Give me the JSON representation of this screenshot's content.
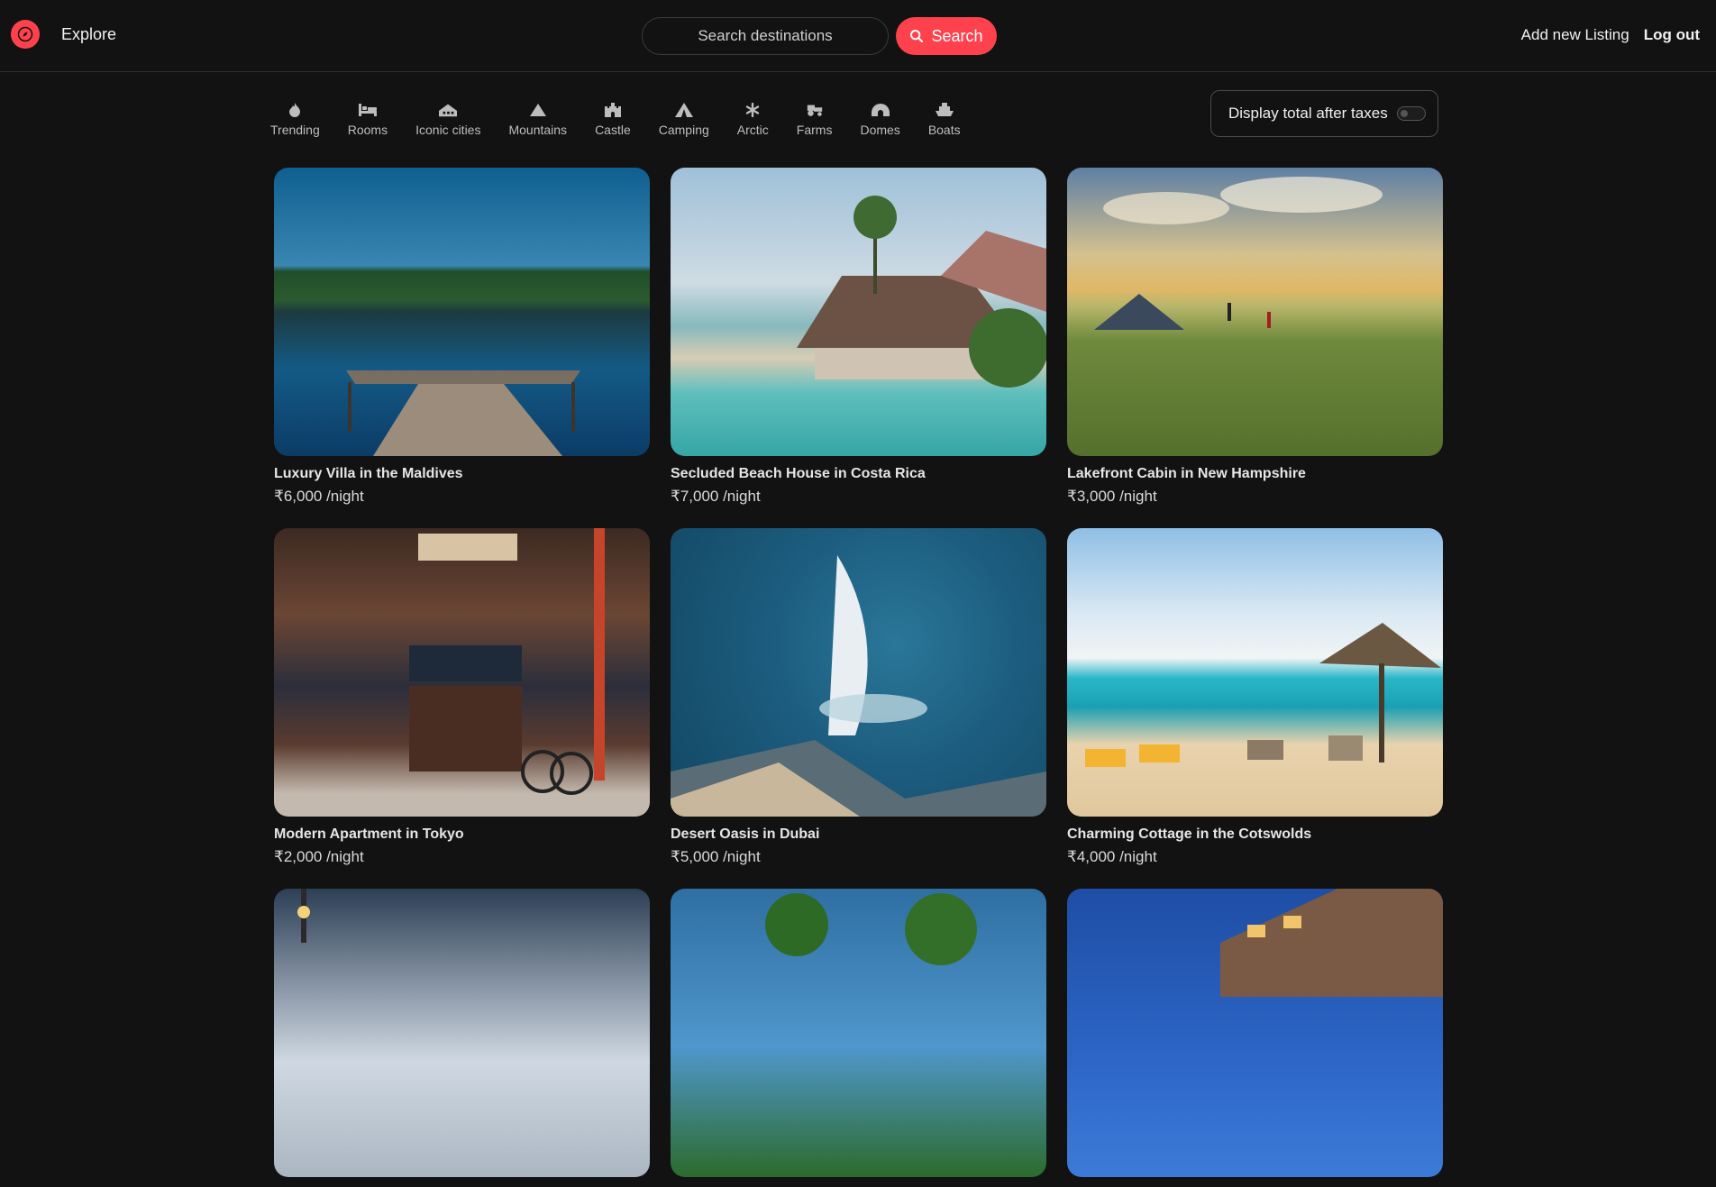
{
  "navbar": {
    "brand_label": "Explore",
    "search_placeholder": "Search destinations",
    "search_button": "Search",
    "add_listing": "Add new Listing",
    "logout": "Log out",
    "accent_color": "#fe424d"
  },
  "filters": [
    {
      "label": "Trending",
      "icon": "fire-icon"
    },
    {
      "label": "Rooms",
      "icon": "bed-icon"
    },
    {
      "label": "Iconic cities",
      "icon": "city-icon"
    },
    {
      "label": "Mountains",
      "icon": "mountain-icon"
    },
    {
      "label": "Castle",
      "icon": "castle-icon"
    },
    {
      "label": "Camping",
      "icon": "tent-icon"
    },
    {
      "label": "Arctic",
      "icon": "snowflake-icon"
    },
    {
      "label": "Farms",
      "icon": "tractor-icon"
    },
    {
      "label": "Domes",
      "icon": "igloo-icon"
    },
    {
      "label": "Boats",
      "icon": "ship-icon"
    }
  ],
  "tax_toggle": {
    "label": "Display total after taxes",
    "enabled": false
  },
  "listings": [
    {
      "title": "Luxury Villa in the Maldives",
      "price": "₹6,000 /night"
    },
    {
      "title": "Secluded Beach House in Costa Rica",
      "price": "₹7,000 /night"
    },
    {
      "title": "Lakefront Cabin in New Hampshire",
      "price": "₹3,000 /night"
    },
    {
      "title": "Modern Apartment in Tokyo",
      "price": "₹2,000 /night"
    },
    {
      "title": "Desert Oasis in Dubai",
      "price": "₹5,000 /night"
    },
    {
      "title": "Charming Cottage in the Cotswolds",
      "price": "₹4,000 /night"
    },
    {
      "title": "",
      "price": ""
    },
    {
      "title": "",
      "price": ""
    },
    {
      "title": "",
      "price": ""
    }
  ]
}
